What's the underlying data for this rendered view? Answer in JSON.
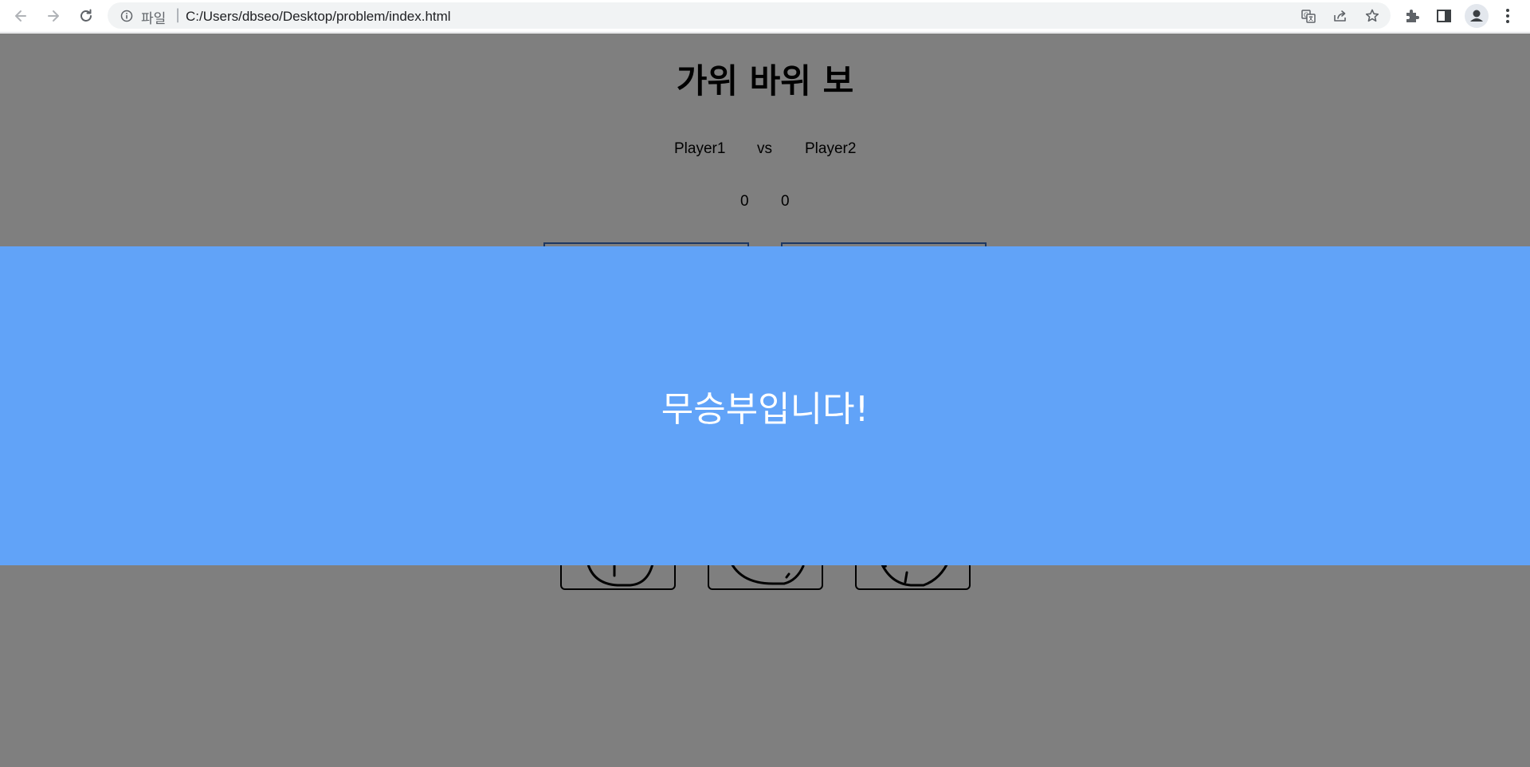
{
  "browser": {
    "scheme_label": "파일",
    "separator": "|",
    "url": "C:/Users/dbseo/Desktop/problem/index.html",
    "icons": [
      "back-arrow-icon",
      "forward-arrow-icon",
      "reload-icon",
      "info-icon",
      "translate-icon",
      "share-icon",
      "bookmark-star-icon",
      "extensions-puzzle-icon",
      "side-panel-icon",
      "profile-avatar-icon",
      "kebab-menu-icon"
    ]
  },
  "game": {
    "title": "가위 바위 보",
    "player1": "Player1",
    "vs": "vs",
    "player2": "Player2",
    "score1": "0",
    "score2": "0",
    "choices": [
      "rock-hand-icon",
      "scissors-hand-icon",
      "paper-hand-icon"
    ]
  },
  "modal": {
    "message": "무승부입니다!"
  },
  "colors": {
    "overlay": "#808080",
    "banner": "#61a3f8",
    "panel_border": "#3a6ec4"
  }
}
